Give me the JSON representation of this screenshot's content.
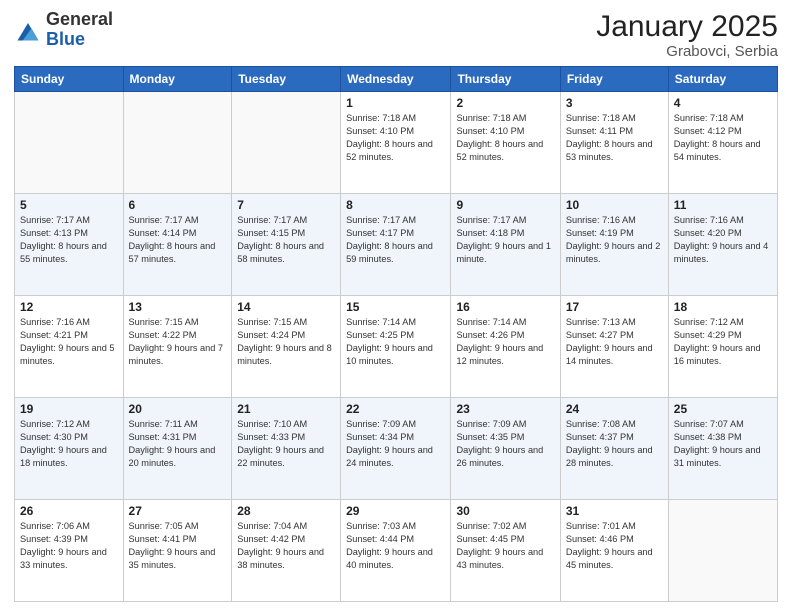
{
  "header": {
    "logo_general": "General",
    "logo_blue": "Blue",
    "month_year": "January 2025",
    "location": "Grabovci, Serbia"
  },
  "weekdays": [
    "Sunday",
    "Monday",
    "Tuesday",
    "Wednesday",
    "Thursday",
    "Friday",
    "Saturday"
  ],
  "weeks": [
    [
      {
        "day": "",
        "sunrise": "",
        "sunset": "",
        "daylight": ""
      },
      {
        "day": "",
        "sunrise": "",
        "sunset": "",
        "daylight": ""
      },
      {
        "day": "",
        "sunrise": "",
        "sunset": "",
        "daylight": ""
      },
      {
        "day": "1",
        "sunrise": "Sunrise: 7:18 AM",
        "sunset": "Sunset: 4:10 PM",
        "daylight": "Daylight: 8 hours and 52 minutes."
      },
      {
        "day": "2",
        "sunrise": "Sunrise: 7:18 AM",
        "sunset": "Sunset: 4:10 PM",
        "daylight": "Daylight: 8 hours and 52 minutes."
      },
      {
        "day": "3",
        "sunrise": "Sunrise: 7:18 AM",
        "sunset": "Sunset: 4:11 PM",
        "daylight": "Daylight: 8 hours and 53 minutes."
      },
      {
        "day": "4",
        "sunrise": "Sunrise: 7:18 AM",
        "sunset": "Sunset: 4:12 PM",
        "daylight": "Daylight: 8 hours and 54 minutes."
      }
    ],
    [
      {
        "day": "5",
        "sunrise": "Sunrise: 7:17 AM",
        "sunset": "Sunset: 4:13 PM",
        "daylight": "Daylight: 8 hours and 55 minutes."
      },
      {
        "day": "6",
        "sunrise": "Sunrise: 7:17 AM",
        "sunset": "Sunset: 4:14 PM",
        "daylight": "Daylight: 8 hours and 57 minutes."
      },
      {
        "day": "7",
        "sunrise": "Sunrise: 7:17 AM",
        "sunset": "Sunset: 4:15 PM",
        "daylight": "Daylight: 8 hours and 58 minutes."
      },
      {
        "day": "8",
        "sunrise": "Sunrise: 7:17 AM",
        "sunset": "Sunset: 4:17 PM",
        "daylight": "Daylight: 8 hours and 59 minutes."
      },
      {
        "day": "9",
        "sunrise": "Sunrise: 7:17 AM",
        "sunset": "Sunset: 4:18 PM",
        "daylight": "Daylight: 9 hours and 1 minute."
      },
      {
        "day": "10",
        "sunrise": "Sunrise: 7:16 AM",
        "sunset": "Sunset: 4:19 PM",
        "daylight": "Daylight: 9 hours and 2 minutes."
      },
      {
        "day": "11",
        "sunrise": "Sunrise: 7:16 AM",
        "sunset": "Sunset: 4:20 PM",
        "daylight": "Daylight: 9 hours and 4 minutes."
      }
    ],
    [
      {
        "day": "12",
        "sunrise": "Sunrise: 7:16 AM",
        "sunset": "Sunset: 4:21 PM",
        "daylight": "Daylight: 9 hours and 5 minutes."
      },
      {
        "day": "13",
        "sunrise": "Sunrise: 7:15 AM",
        "sunset": "Sunset: 4:22 PM",
        "daylight": "Daylight: 9 hours and 7 minutes."
      },
      {
        "day": "14",
        "sunrise": "Sunrise: 7:15 AM",
        "sunset": "Sunset: 4:24 PM",
        "daylight": "Daylight: 9 hours and 8 minutes."
      },
      {
        "day": "15",
        "sunrise": "Sunrise: 7:14 AM",
        "sunset": "Sunset: 4:25 PM",
        "daylight": "Daylight: 9 hours and 10 minutes."
      },
      {
        "day": "16",
        "sunrise": "Sunrise: 7:14 AM",
        "sunset": "Sunset: 4:26 PM",
        "daylight": "Daylight: 9 hours and 12 minutes."
      },
      {
        "day": "17",
        "sunrise": "Sunrise: 7:13 AM",
        "sunset": "Sunset: 4:27 PM",
        "daylight": "Daylight: 9 hours and 14 minutes."
      },
      {
        "day": "18",
        "sunrise": "Sunrise: 7:12 AM",
        "sunset": "Sunset: 4:29 PM",
        "daylight": "Daylight: 9 hours and 16 minutes."
      }
    ],
    [
      {
        "day": "19",
        "sunrise": "Sunrise: 7:12 AM",
        "sunset": "Sunset: 4:30 PM",
        "daylight": "Daylight: 9 hours and 18 minutes."
      },
      {
        "day": "20",
        "sunrise": "Sunrise: 7:11 AM",
        "sunset": "Sunset: 4:31 PM",
        "daylight": "Daylight: 9 hours and 20 minutes."
      },
      {
        "day": "21",
        "sunrise": "Sunrise: 7:10 AM",
        "sunset": "Sunset: 4:33 PM",
        "daylight": "Daylight: 9 hours and 22 minutes."
      },
      {
        "day": "22",
        "sunrise": "Sunrise: 7:09 AM",
        "sunset": "Sunset: 4:34 PM",
        "daylight": "Daylight: 9 hours and 24 minutes."
      },
      {
        "day": "23",
        "sunrise": "Sunrise: 7:09 AM",
        "sunset": "Sunset: 4:35 PM",
        "daylight": "Daylight: 9 hours and 26 minutes."
      },
      {
        "day": "24",
        "sunrise": "Sunrise: 7:08 AM",
        "sunset": "Sunset: 4:37 PM",
        "daylight": "Daylight: 9 hours and 28 minutes."
      },
      {
        "day": "25",
        "sunrise": "Sunrise: 7:07 AM",
        "sunset": "Sunset: 4:38 PM",
        "daylight": "Daylight: 9 hours and 31 minutes."
      }
    ],
    [
      {
        "day": "26",
        "sunrise": "Sunrise: 7:06 AM",
        "sunset": "Sunset: 4:39 PM",
        "daylight": "Daylight: 9 hours and 33 minutes."
      },
      {
        "day": "27",
        "sunrise": "Sunrise: 7:05 AM",
        "sunset": "Sunset: 4:41 PM",
        "daylight": "Daylight: 9 hours and 35 minutes."
      },
      {
        "day": "28",
        "sunrise": "Sunrise: 7:04 AM",
        "sunset": "Sunset: 4:42 PM",
        "daylight": "Daylight: 9 hours and 38 minutes."
      },
      {
        "day": "29",
        "sunrise": "Sunrise: 7:03 AM",
        "sunset": "Sunset: 4:44 PM",
        "daylight": "Daylight: 9 hours and 40 minutes."
      },
      {
        "day": "30",
        "sunrise": "Sunrise: 7:02 AM",
        "sunset": "Sunset: 4:45 PM",
        "daylight": "Daylight: 9 hours and 43 minutes."
      },
      {
        "day": "31",
        "sunrise": "Sunrise: 7:01 AM",
        "sunset": "Sunset: 4:46 PM",
        "daylight": "Daylight: 9 hours and 45 minutes."
      },
      {
        "day": "",
        "sunrise": "",
        "sunset": "",
        "daylight": ""
      }
    ]
  ]
}
